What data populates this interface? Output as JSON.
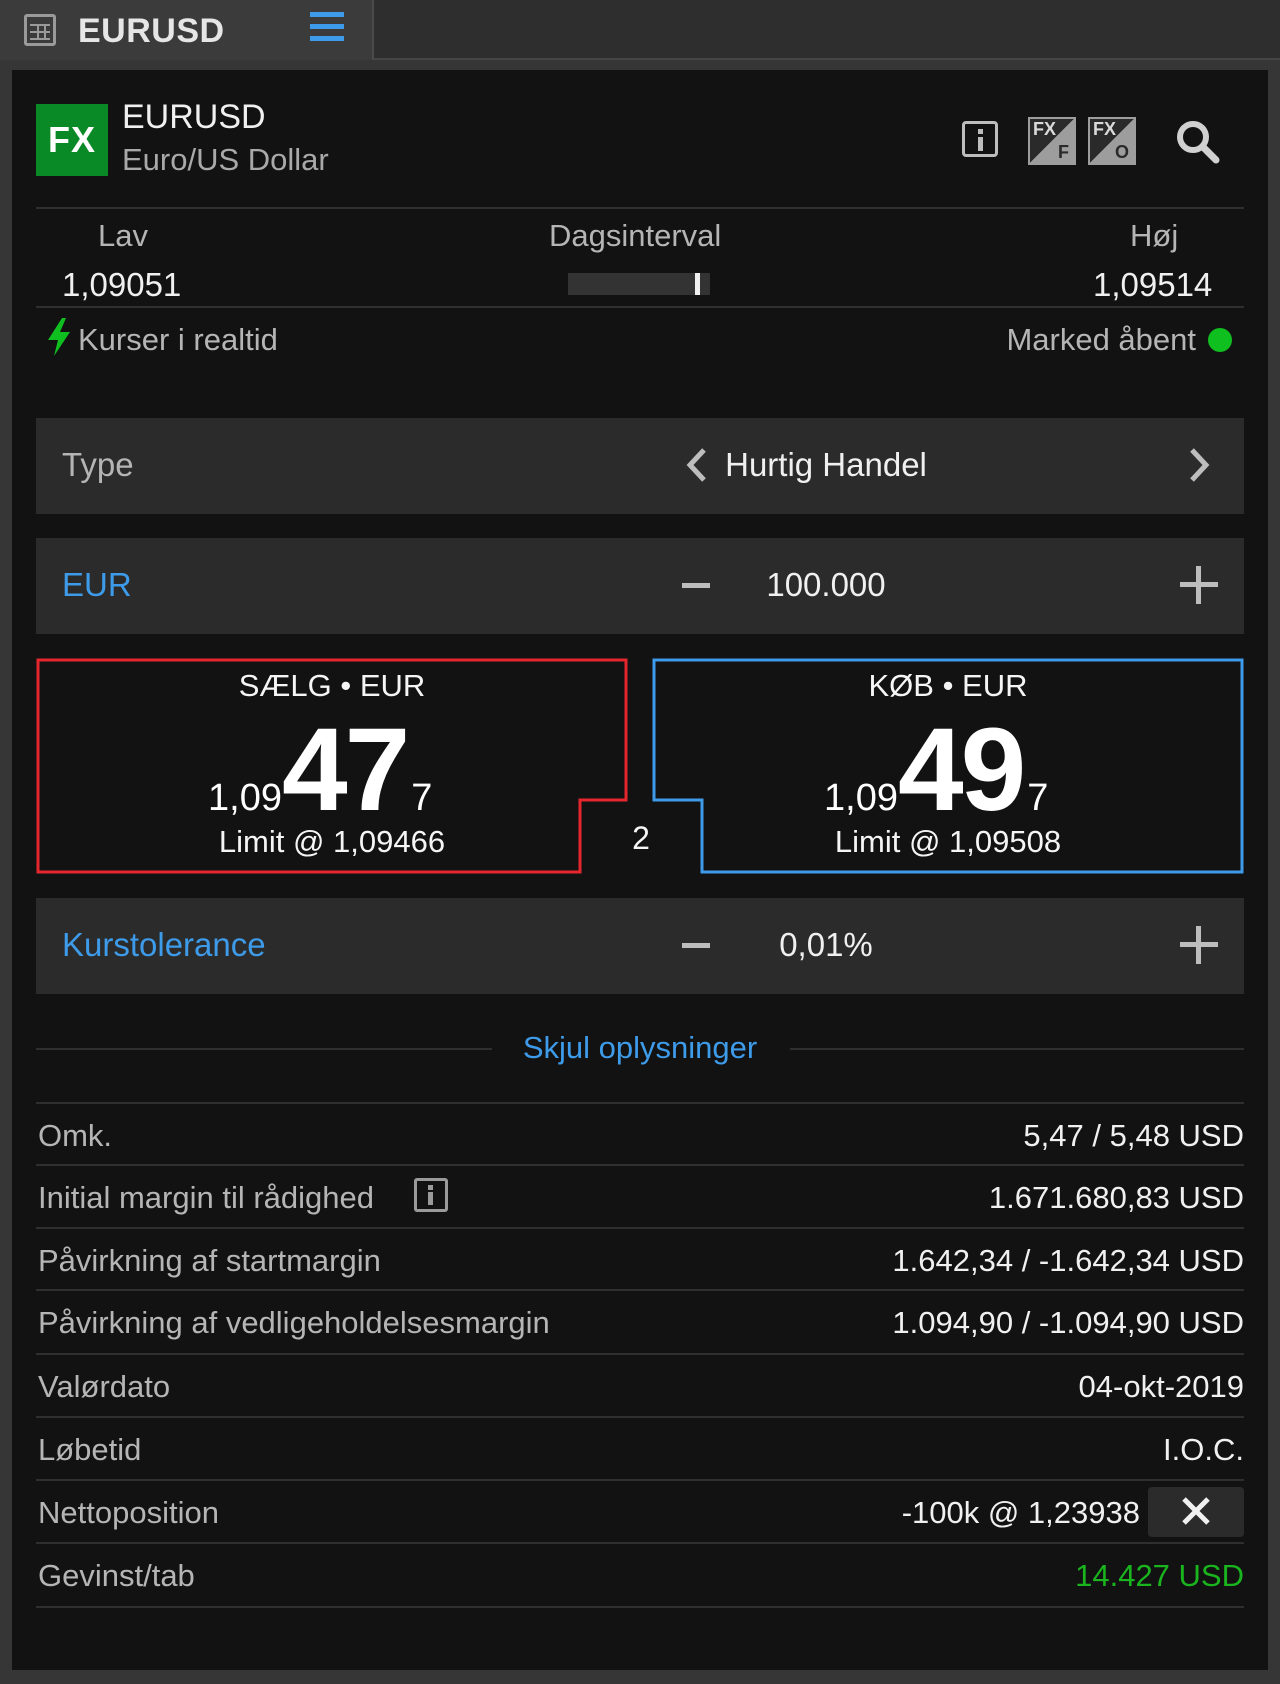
{
  "tab": {
    "title": "EURUSD"
  },
  "instrument": {
    "badge": "FX",
    "symbol": "EURUSD",
    "description": "Euro/US Dollar",
    "fx_icon_1": {
      "top": "FX",
      "bottom": "F"
    },
    "fx_icon_2": {
      "top": "FX",
      "bottom": "O"
    }
  },
  "day_range": {
    "low_label": "Lav",
    "low_value": "1,09051",
    "range_label": "Dagsinterval",
    "high_label": "Høj",
    "high_value": "1,09514",
    "current_position_fraction": 0.93
  },
  "status": {
    "realtime_label": "Kurser i realtid",
    "market_label": "Marked åbent",
    "market_color": "#0fbf1f"
  },
  "order_type": {
    "label": "Type",
    "value": "Hurtig Handel"
  },
  "amount": {
    "currency": "EUR",
    "value": "100.000"
  },
  "sell": {
    "label": "SÆLG • EUR",
    "price_prefix": "1,09",
    "price_big": "47",
    "price_suffix": "7",
    "limit": "Limit @ 1,09466",
    "color": "#e5262d"
  },
  "buy": {
    "label": "KØB • EUR",
    "price_prefix": "1,09",
    "price_big": "49",
    "price_suffix": "7",
    "limit": "Limit @ 1,09508",
    "color": "#3d9be9"
  },
  "spread": "2",
  "tolerance": {
    "label": "Kurstolerance",
    "value": "0,01%"
  },
  "details_toggle": "Skjul oplysninger",
  "details": {
    "cost_label": "Omk.",
    "cost_value": "5,47 / 5,48 USD",
    "initial_margin_label": "Initial margin til rådighed",
    "initial_margin_value": "1.671.680,83 USD",
    "start_margin_label": "Påvirkning af startmargin",
    "start_margin_value": "1.642,34 / -1.642,34 USD",
    "maintenance_label": "Påvirkning af vedligeholdelsesmargin",
    "maintenance_value": "1.094,90 / -1.094,90 USD",
    "value_date_label": "Valørdato",
    "value_date_value": "04-okt-2019",
    "duration_label": "Løbetid",
    "duration_value": "I.O.C.",
    "net_position_label": "Nettoposition",
    "net_position_value": "-100k @ 1,23938",
    "pnl_label": "Gevinst/tab",
    "pnl_value": "14.427 USD",
    "pnl_color": "#19b41e"
  },
  "colors": {
    "accent": "#3d9be9",
    "badge_green": "#0a8a26"
  }
}
